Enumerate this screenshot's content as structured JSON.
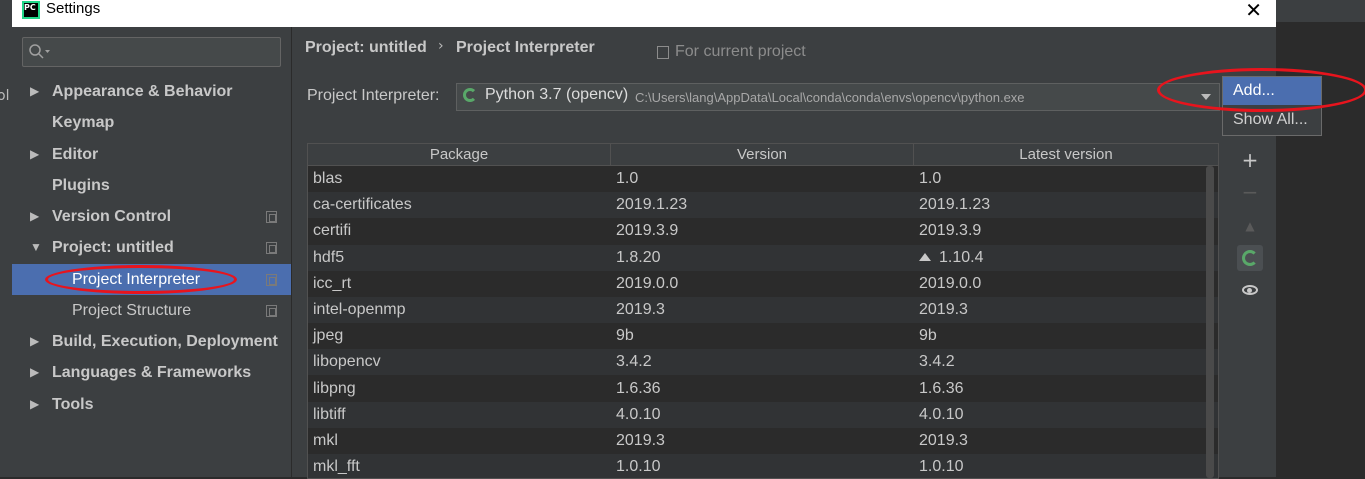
{
  "window": {
    "title": "Settings",
    "app_icon": "PC",
    "close_label": "✕"
  },
  "background_fragment": "ol",
  "sidebar": {
    "items": [
      {
        "label": "Appearance & Behavior",
        "arrow": "▶"
      },
      {
        "label": "Keymap"
      },
      {
        "label": "Editor",
        "arrow": "▶"
      },
      {
        "label": "Plugins"
      },
      {
        "label": "Version Control",
        "arrow": "▶"
      },
      {
        "label": "Project: untitled",
        "arrow": "▼"
      },
      {
        "label": "Project Interpreter",
        "selected": true
      },
      {
        "label": "Project Structure"
      },
      {
        "label": "Build, Execution, Deployment",
        "arrow": "▶"
      },
      {
        "label": "Languages & Frameworks",
        "arrow": "▶"
      },
      {
        "label": "Tools",
        "arrow": "▶"
      }
    ]
  },
  "breadcrumb": {
    "project": "Project: untitled",
    "separator": "›",
    "page": "Project Interpreter",
    "scope": "For current project"
  },
  "interpreter": {
    "label": "Project Interpreter:",
    "name": "Python 3.7 (opencv)",
    "path": "C:\\Users\\lang\\AppData\\Local\\conda\\conda\\envs\\opencv\\python.exe"
  },
  "gear_menu": {
    "add": "Add...",
    "show_all": "Show All..."
  },
  "table": {
    "headers": [
      "Package",
      "Version",
      "Latest version"
    ],
    "rows": [
      {
        "package": "blas",
        "version": "1.0",
        "latest": "1.0"
      },
      {
        "package": "ca-certificates",
        "version": "2019.1.23",
        "latest": "2019.1.23"
      },
      {
        "package": "certifi",
        "version": "2019.3.9",
        "latest": "2019.3.9"
      },
      {
        "package": "hdf5",
        "version": "1.8.20",
        "latest": "1.10.4",
        "upgrade": true
      },
      {
        "package": "icc_rt",
        "version": "2019.0.0",
        "latest": "2019.0.0"
      },
      {
        "package": "intel-openmp",
        "version": "2019.3",
        "latest": "2019.3"
      },
      {
        "package": "jpeg",
        "version": "9b",
        "latest": "9b"
      },
      {
        "package": "libopencv",
        "version": "3.4.2",
        "latest": "3.4.2"
      },
      {
        "package": "libpng",
        "version": "1.6.36",
        "latest": "1.6.36"
      },
      {
        "package": "libtiff",
        "version": "4.0.10",
        "latest": "4.0.10"
      },
      {
        "package": "mkl",
        "version": "2019.3",
        "latest": "2019.3"
      },
      {
        "package": "mkl_fft",
        "version": "1.0.10",
        "latest": "1.0.10"
      }
    ]
  },
  "toolbar": {
    "add": "+",
    "remove": "−",
    "upgrade": "▲"
  },
  "colors": {
    "selection": "#4b6eaf",
    "annotation": "#e8141d",
    "progress_green": "#59a869"
  }
}
